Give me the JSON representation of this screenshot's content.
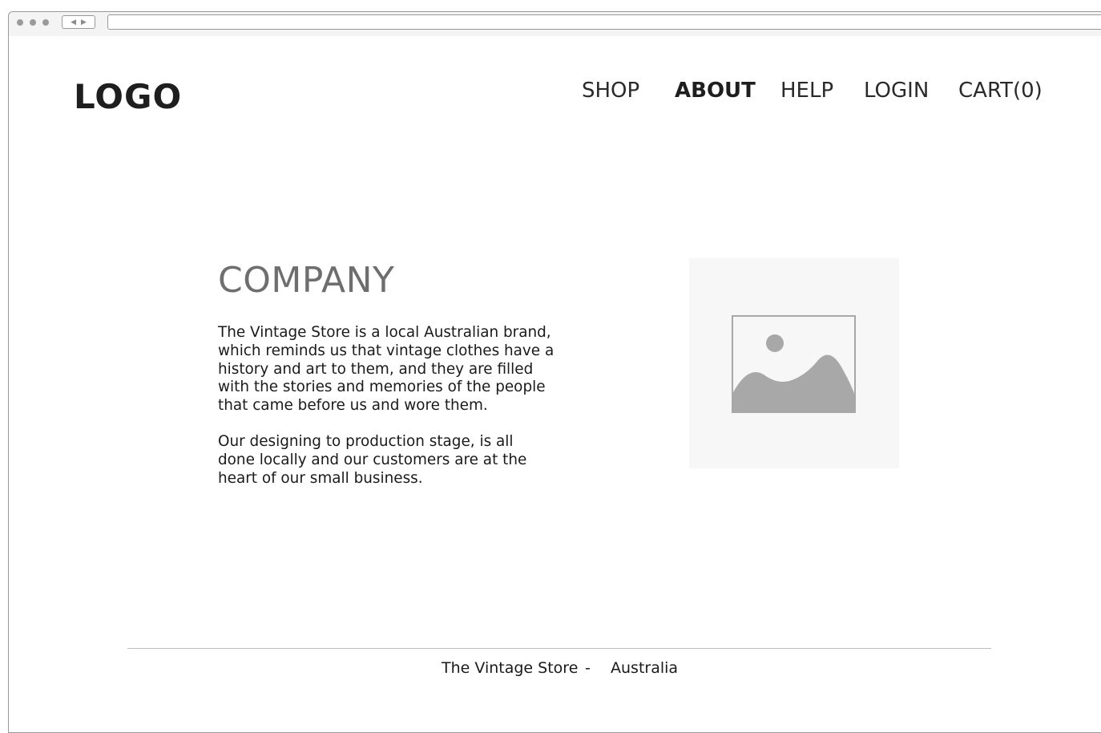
{
  "browser": {
    "window_dots": [
      "dot",
      "dot",
      "dot"
    ],
    "back_icon": "◀",
    "forward_icon": "▶",
    "url": ""
  },
  "header": {
    "logo": "LOGO",
    "nav": [
      {
        "label": "SHOP",
        "active": false
      },
      {
        "label": "ABOUT",
        "active": true
      },
      {
        "label": "HELP",
        "active": false
      },
      {
        "label": "LOGIN",
        "active": false
      },
      {
        "label": "CART(0)",
        "active": false
      }
    ]
  },
  "main": {
    "heading": "COMPANY",
    "paragraphs": [
      "The Vintage Store is a local Australian brand, which reminds us that vintage clothes have a history and art to them, and they are filled with the stories and memories of the people that came before us and wore them.",
      "Our designing to production stage, is all done locally and our customers are at the heart of our small business."
    ],
    "image": {
      "icon": "image-placeholder-icon",
      "background_color": "#f7f7f7",
      "icon_color": "#a8a8a8"
    }
  },
  "footer": {
    "store": "The Vintage Store",
    "separator": "-",
    "location": "Australia"
  },
  "colors": {
    "frame_border": "#9a9a9a",
    "heading": "#6e6e6e",
    "text": "#1a1a1a",
    "divider": "#bdbdbd"
  }
}
